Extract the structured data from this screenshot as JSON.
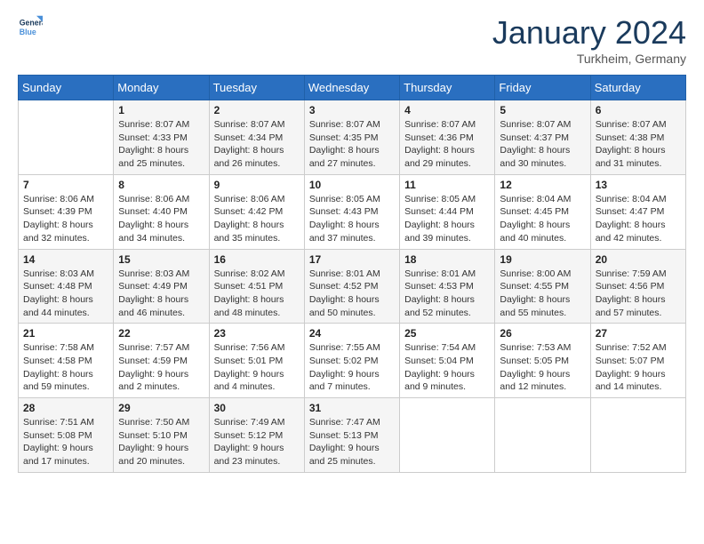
{
  "header": {
    "logo_line1": "General",
    "logo_line2": "Blue",
    "month_year": "January 2024",
    "location": "Turkheim, Germany"
  },
  "days_of_week": [
    "Sunday",
    "Monday",
    "Tuesday",
    "Wednesday",
    "Thursday",
    "Friday",
    "Saturday"
  ],
  "weeks": [
    [
      {
        "day": "",
        "info": ""
      },
      {
        "day": "1",
        "info": "Sunrise: 8:07 AM\nSunset: 4:33 PM\nDaylight: 8 hours\nand 25 minutes."
      },
      {
        "day": "2",
        "info": "Sunrise: 8:07 AM\nSunset: 4:34 PM\nDaylight: 8 hours\nand 26 minutes."
      },
      {
        "day": "3",
        "info": "Sunrise: 8:07 AM\nSunset: 4:35 PM\nDaylight: 8 hours\nand 27 minutes."
      },
      {
        "day": "4",
        "info": "Sunrise: 8:07 AM\nSunset: 4:36 PM\nDaylight: 8 hours\nand 29 minutes."
      },
      {
        "day": "5",
        "info": "Sunrise: 8:07 AM\nSunset: 4:37 PM\nDaylight: 8 hours\nand 30 minutes."
      },
      {
        "day": "6",
        "info": "Sunrise: 8:07 AM\nSunset: 4:38 PM\nDaylight: 8 hours\nand 31 minutes."
      }
    ],
    [
      {
        "day": "7",
        "info": "Sunrise: 8:06 AM\nSunset: 4:39 PM\nDaylight: 8 hours\nand 32 minutes."
      },
      {
        "day": "8",
        "info": "Sunrise: 8:06 AM\nSunset: 4:40 PM\nDaylight: 8 hours\nand 34 minutes."
      },
      {
        "day": "9",
        "info": "Sunrise: 8:06 AM\nSunset: 4:42 PM\nDaylight: 8 hours\nand 35 minutes."
      },
      {
        "day": "10",
        "info": "Sunrise: 8:05 AM\nSunset: 4:43 PM\nDaylight: 8 hours\nand 37 minutes."
      },
      {
        "day": "11",
        "info": "Sunrise: 8:05 AM\nSunset: 4:44 PM\nDaylight: 8 hours\nand 39 minutes."
      },
      {
        "day": "12",
        "info": "Sunrise: 8:04 AM\nSunset: 4:45 PM\nDaylight: 8 hours\nand 40 minutes."
      },
      {
        "day": "13",
        "info": "Sunrise: 8:04 AM\nSunset: 4:47 PM\nDaylight: 8 hours\nand 42 minutes."
      }
    ],
    [
      {
        "day": "14",
        "info": "Sunrise: 8:03 AM\nSunset: 4:48 PM\nDaylight: 8 hours\nand 44 minutes."
      },
      {
        "day": "15",
        "info": "Sunrise: 8:03 AM\nSunset: 4:49 PM\nDaylight: 8 hours\nand 46 minutes."
      },
      {
        "day": "16",
        "info": "Sunrise: 8:02 AM\nSunset: 4:51 PM\nDaylight: 8 hours\nand 48 minutes."
      },
      {
        "day": "17",
        "info": "Sunrise: 8:01 AM\nSunset: 4:52 PM\nDaylight: 8 hours\nand 50 minutes."
      },
      {
        "day": "18",
        "info": "Sunrise: 8:01 AM\nSunset: 4:53 PM\nDaylight: 8 hours\nand 52 minutes."
      },
      {
        "day": "19",
        "info": "Sunrise: 8:00 AM\nSunset: 4:55 PM\nDaylight: 8 hours\nand 55 minutes."
      },
      {
        "day": "20",
        "info": "Sunrise: 7:59 AM\nSunset: 4:56 PM\nDaylight: 8 hours\nand 57 minutes."
      }
    ],
    [
      {
        "day": "21",
        "info": "Sunrise: 7:58 AM\nSunset: 4:58 PM\nDaylight: 8 hours\nand 59 minutes."
      },
      {
        "day": "22",
        "info": "Sunrise: 7:57 AM\nSunset: 4:59 PM\nDaylight: 9 hours\nand 2 minutes."
      },
      {
        "day": "23",
        "info": "Sunrise: 7:56 AM\nSunset: 5:01 PM\nDaylight: 9 hours\nand 4 minutes."
      },
      {
        "day": "24",
        "info": "Sunrise: 7:55 AM\nSunset: 5:02 PM\nDaylight: 9 hours\nand 7 minutes."
      },
      {
        "day": "25",
        "info": "Sunrise: 7:54 AM\nSunset: 5:04 PM\nDaylight: 9 hours\nand 9 minutes."
      },
      {
        "day": "26",
        "info": "Sunrise: 7:53 AM\nSunset: 5:05 PM\nDaylight: 9 hours\nand 12 minutes."
      },
      {
        "day": "27",
        "info": "Sunrise: 7:52 AM\nSunset: 5:07 PM\nDaylight: 9 hours\nand 14 minutes."
      }
    ],
    [
      {
        "day": "28",
        "info": "Sunrise: 7:51 AM\nSunset: 5:08 PM\nDaylight: 9 hours\nand 17 minutes."
      },
      {
        "day": "29",
        "info": "Sunrise: 7:50 AM\nSunset: 5:10 PM\nDaylight: 9 hours\nand 20 minutes."
      },
      {
        "day": "30",
        "info": "Sunrise: 7:49 AM\nSunset: 5:12 PM\nDaylight: 9 hours\nand 23 minutes."
      },
      {
        "day": "31",
        "info": "Sunrise: 7:47 AM\nSunset: 5:13 PM\nDaylight: 9 hours\nand 25 minutes."
      },
      {
        "day": "",
        "info": ""
      },
      {
        "day": "",
        "info": ""
      },
      {
        "day": "",
        "info": ""
      }
    ]
  ]
}
